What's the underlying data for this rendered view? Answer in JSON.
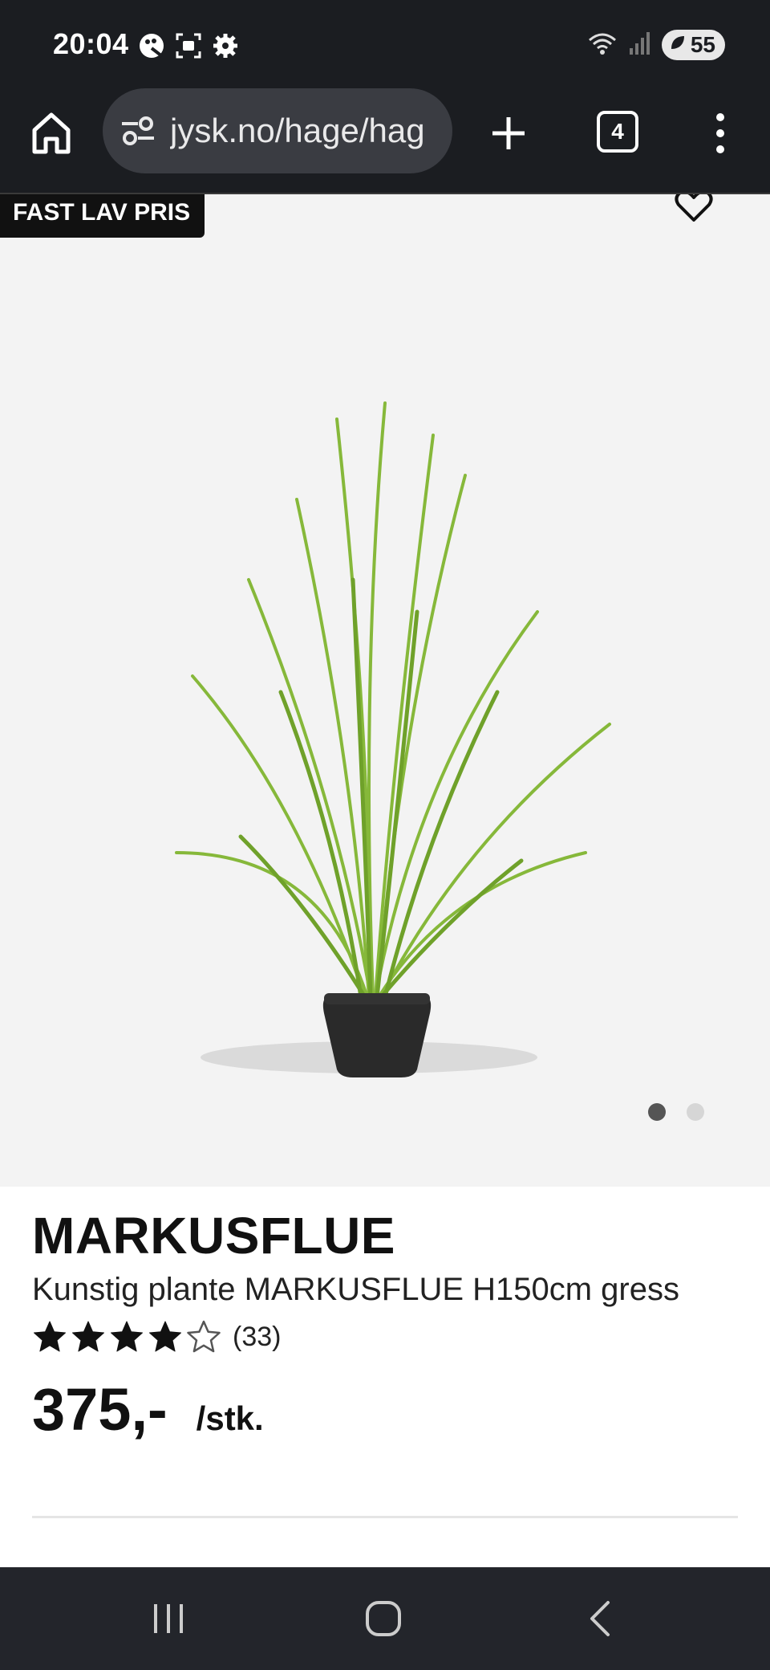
{
  "status_bar": {
    "time": "20:04",
    "battery": "55",
    "icons": [
      "palette-icon",
      "screenshot-icon",
      "gear-icon",
      "wifi-icon",
      "signal-icon",
      "battery-icon"
    ]
  },
  "browser": {
    "url": "jysk.no/hage/hag",
    "tab_count": "4",
    "icons": [
      "home-icon",
      "site-settings-icon",
      "plus-icon",
      "tabs-icon",
      "more-icon"
    ]
  },
  "gallery": {
    "badge": "FAST LAV PRIS",
    "slide_count": 2,
    "active_slide": 0
  },
  "product": {
    "name": "MARKUSFLUE",
    "description": "Kunstig plante MARKUSFLUE H150cm gress",
    "rating": 4,
    "rating_max": 5,
    "review_count": "(33)",
    "price": "375,-",
    "unit": "/stk."
  },
  "colors": {
    "chrome": "#1b1d21",
    "urlbar": "#3a3c42",
    "gallery_bg": "#f3f3f3",
    "text": "#111111"
  }
}
